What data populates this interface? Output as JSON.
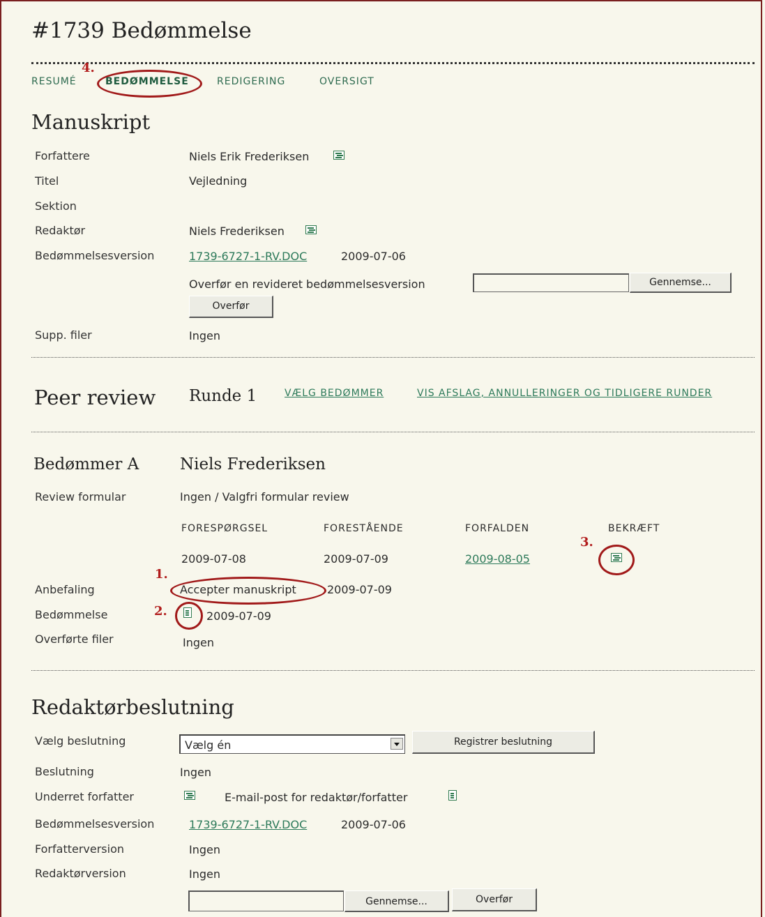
{
  "page": {
    "title": "#1739 Bedømmelse"
  },
  "tabs": [
    {
      "label": "RESUMÉ"
    },
    {
      "label": "BEDØMMELSE"
    },
    {
      "label": "REDIGERING"
    },
    {
      "label": "OVERSIGT"
    }
  ],
  "manuscript": {
    "heading": "Manuskript",
    "authors_label": "Forfattere",
    "authors_value": "Niels Erik Frederiksen",
    "title_label": "Titel",
    "title_value": "Vejledning",
    "section_label": "Sektion",
    "editor_label": "Redaktør",
    "editor_value": "Niels Frederiksen",
    "review_version_label": "Bedømmelsesversion",
    "review_version_file": "1739-6727-1-RV.DOC",
    "review_version_date": "2009-07-06",
    "upload_label": "Overfør en revideret bedømmelsesversion",
    "browse_button": "Gennemse...",
    "upload_button": "Overfør",
    "supp_label": "Supp. filer",
    "supp_value": "Ingen"
  },
  "peer_review": {
    "heading": "Peer review",
    "round": "Runde 1",
    "select_reviewer_link": "VÆLG BEDØMMER",
    "show_rejections_link": "VIS AFSLAG, ANNULLERINGER OG TIDLIGERE RUNDER"
  },
  "reviewer": {
    "label": "Bedømmer A",
    "name": "Niels Frederiksen",
    "form_label": "Review formular",
    "form_value": "Ingen / Valgfri formular review",
    "col_request": "FORESPØRGSEL",
    "col_underway": "FORESTÅENDE",
    "col_due": "FORFALDEN",
    "col_ack": "BEKRÆFT",
    "date_request": "2009-07-08",
    "date_underway": "2009-07-09",
    "date_due": "2009-08-05",
    "recommendation_label": "Anbefaling",
    "recommendation_value": "Accepter manuskript",
    "recommendation_date": "2009-07-09",
    "review_label": "Bedømmelse",
    "review_date": "2009-07-09",
    "uploaded_label": "Overførte filer",
    "uploaded_value": "Ingen"
  },
  "annotations": {
    "a1": "1.",
    "a2": "2.",
    "a3": "3.",
    "a4": "4."
  },
  "decision": {
    "heading": "Redaktørbeslutning",
    "choose_label": "Vælg beslutning",
    "choose_value": "Vælg én",
    "register_button": "Registrer beslutning",
    "decision_label": "Beslutning",
    "decision_value": "Ingen",
    "notify_label": "Underret forfatter",
    "email_log": "E-mail-post for redaktør/forfatter",
    "review_version_label": "Bedømmelsesversion",
    "review_version_file": "1739-6727-1-RV.DOC",
    "review_version_date": "2009-07-06",
    "author_version_label": "Forfatterversion",
    "author_version_value": "Ingen",
    "editor_version_label": "Redaktørversion",
    "editor_version_value": "Ingen",
    "browse_button": "Gennemse...",
    "upload_button": "Overfør"
  },
  "colors": {
    "accent_link": "#2d7a5a",
    "annotation_red": "#a11a1a",
    "background": "#f8f7ec"
  }
}
